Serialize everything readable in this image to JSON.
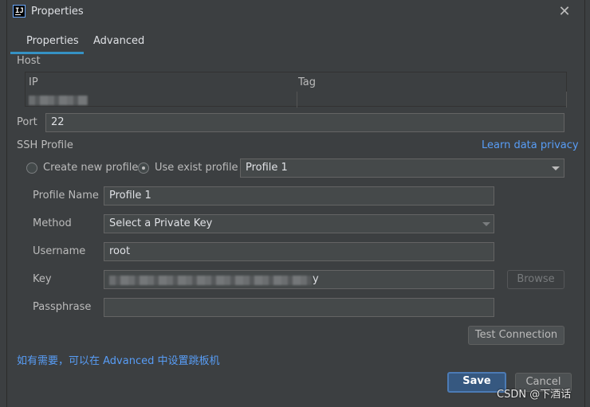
{
  "window": {
    "title": "Properties"
  },
  "tabs": [
    {
      "label": "Properties",
      "active": true
    },
    {
      "label": "Advanced",
      "active": false
    }
  ],
  "host": {
    "section_label": "Host",
    "columns": [
      "IP",
      "Tag"
    ]
  },
  "port": {
    "label": "Port",
    "value": "22"
  },
  "ssh_profile": {
    "section_label": "SSH Profile",
    "privacy_link": "Learn data privacy",
    "radio_new": "Create new profile",
    "radio_exist": "Use exist profile",
    "selected_profile": "Profile 1"
  },
  "profile_form": {
    "profile_name_label": "Profile Name",
    "profile_name_value": "Profile 1",
    "method_label": "Method",
    "method_value": "Select a Private Key",
    "username_label": "Username",
    "username_value": "root",
    "key_label": "Key",
    "key_value_suffix": "y",
    "browse_label": "Browse",
    "passphrase_label": "Passphrase",
    "passphrase_value": ""
  },
  "test_connection_label": "Test Connection",
  "advanced_hint": "如有需要，可以在 Advanced 中设置跳板机",
  "footer": {
    "save_label": "Save",
    "cancel_label": "Cancel"
  },
  "watermark": "CSDN @下酒话",
  "colors": {
    "accent": "#3592c4",
    "link": "#589df6",
    "primary_button": "#365880"
  }
}
